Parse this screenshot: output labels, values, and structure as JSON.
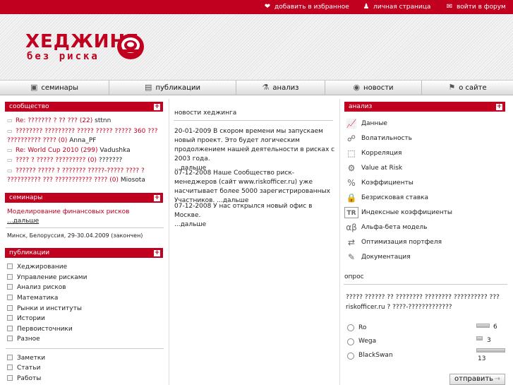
{
  "topbar": {
    "links": [
      "добавить в избранное",
      "личная страница",
      "войти в форум"
    ],
    "icons": [
      "heart-icon",
      "user-icon",
      "chat-icon"
    ]
  },
  "logo": {
    "title": "ХЕДЖИНГ",
    "subtitle": "без риска"
  },
  "nav": {
    "items": [
      "семинары",
      "публикации",
      "анализ",
      "новости",
      "о сайте"
    ],
    "icons": [
      "box-icon",
      "book-icon",
      "chemistry-icon",
      "globe-icon",
      "flag-icon"
    ]
  },
  "community": {
    "title": "сообщество",
    "posts": [
      {
        "title": "Re: ??????? ? ?? ??? (22)",
        "author": "sttnn"
      },
      {
        "title": "???????? ????????? ????? ????? ????? 360 ??? ?????????? ???? (0)",
        "author": "Anna_PF"
      },
      {
        "title": "Re: World Cup 2010 (299)",
        "author": "Vadushka"
      },
      {
        "title": "???? ? ????? ????????? (0)",
        "author": "???????"
      },
      {
        "title": "?????? ????? ? ??????? ?????-????? ???? ? ?????????? ??? ??????????? ???? (0)",
        "author": "Miosota"
      }
    ]
  },
  "seminars": {
    "title": "семинары",
    "item_title": "Моделирование финансовых рисков",
    "more": "...дальше",
    "info": "Минск, Белоруссия, 29-30.04.2009 (закончен)"
  },
  "publications": {
    "title": "публикации",
    "group1": [
      "Хеджирование",
      "Управление рисками",
      "Анализ рисков",
      "Математика",
      "Рынки и институты",
      "Истории",
      "Первоисточники",
      "Разное"
    ],
    "group2": [
      "Заметки",
      "Статьи",
      "Работы"
    ]
  },
  "news": {
    "title": "новости хеджинга",
    "items": [
      {
        "text": "20-01-2009 В скором времени мы запускаем новый проект. Это будет логическим продолжением нашей деятельности в рисках с 2003 года.",
        "more": "...дальше"
      },
      {
        "text": "07-12-2008 Наше Сообщество риск-менеджеров (сайт www.riskofficer.ru) уже насчитывает более 5000 зарегистрированных Участников.",
        "more": "...дальше"
      },
      {
        "text": "07-12-2008 У нас открылся новый офис в Москве.",
        "more": "...дальше"
      }
    ]
  },
  "analysis": {
    "title": "анализ",
    "items": [
      "Данные",
      "Волатильность",
      "Корреляция",
      "Value at Risk",
      "Коэффициенты",
      "Безрисковая ставка",
      "Индексные коэффициенты",
      "Альфа-бета модель",
      "Оптимизация портфеля",
      "Документация"
    ]
  },
  "poll": {
    "title": "опрос",
    "question": "????? ?????? ?? ???????? ???????? ?????????? ??? riskofficer.ru ? ????-?????????????",
    "options": [
      {
        "label": "Ro",
        "count": "6",
        "value": 6
      },
      {
        "label": "Wega",
        "count": "3",
        "value": 3
      },
      {
        "label": "BlackSwan",
        "count": "13",
        "value": 13
      }
    ],
    "submit": "отправить"
  }
}
